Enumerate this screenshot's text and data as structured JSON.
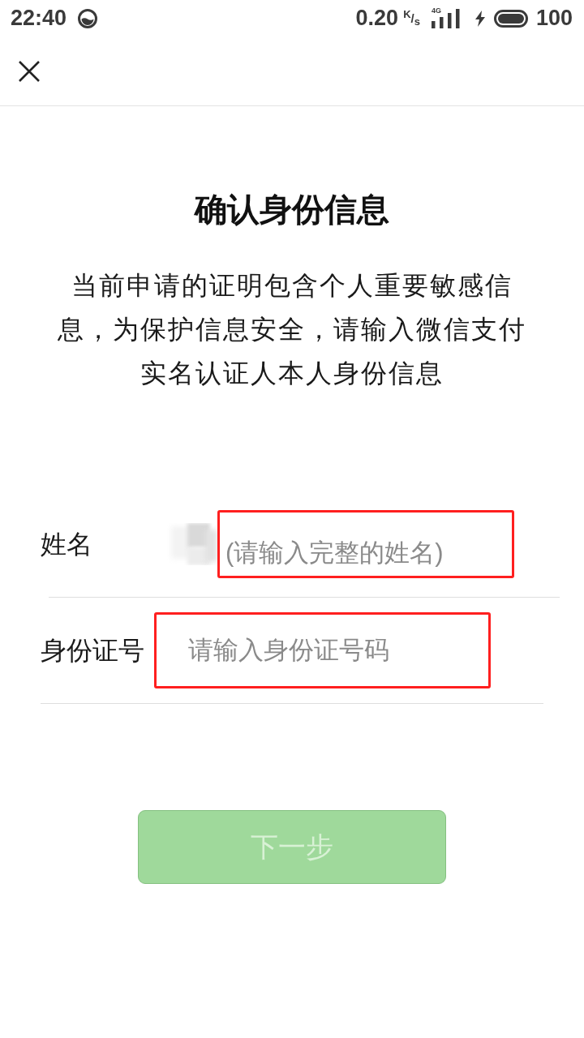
{
  "status_bar": {
    "time": "22:40",
    "net_speed": "0.20",
    "speed_unit": "$^{K}$/$_{s}$",
    "network": "4G",
    "charging": true,
    "battery": "100"
  },
  "title": "确认身份信息",
  "description": "当前申请的证明包含个人重要敏感信息，为保护信息安全，请输入微信支付实名认证人本人身份信息",
  "fields": [
    {
      "label": "姓名",
      "placeholder": "(请输入完整的姓名)",
      "redacted": true,
      "highlighted": true
    },
    {
      "label": "身份证号",
      "placeholder": "请输入身份证号码",
      "redacted": false,
      "highlighted": true
    }
  ],
  "next_button": {
    "label": "下一步",
    "disabled": true
  }
}
